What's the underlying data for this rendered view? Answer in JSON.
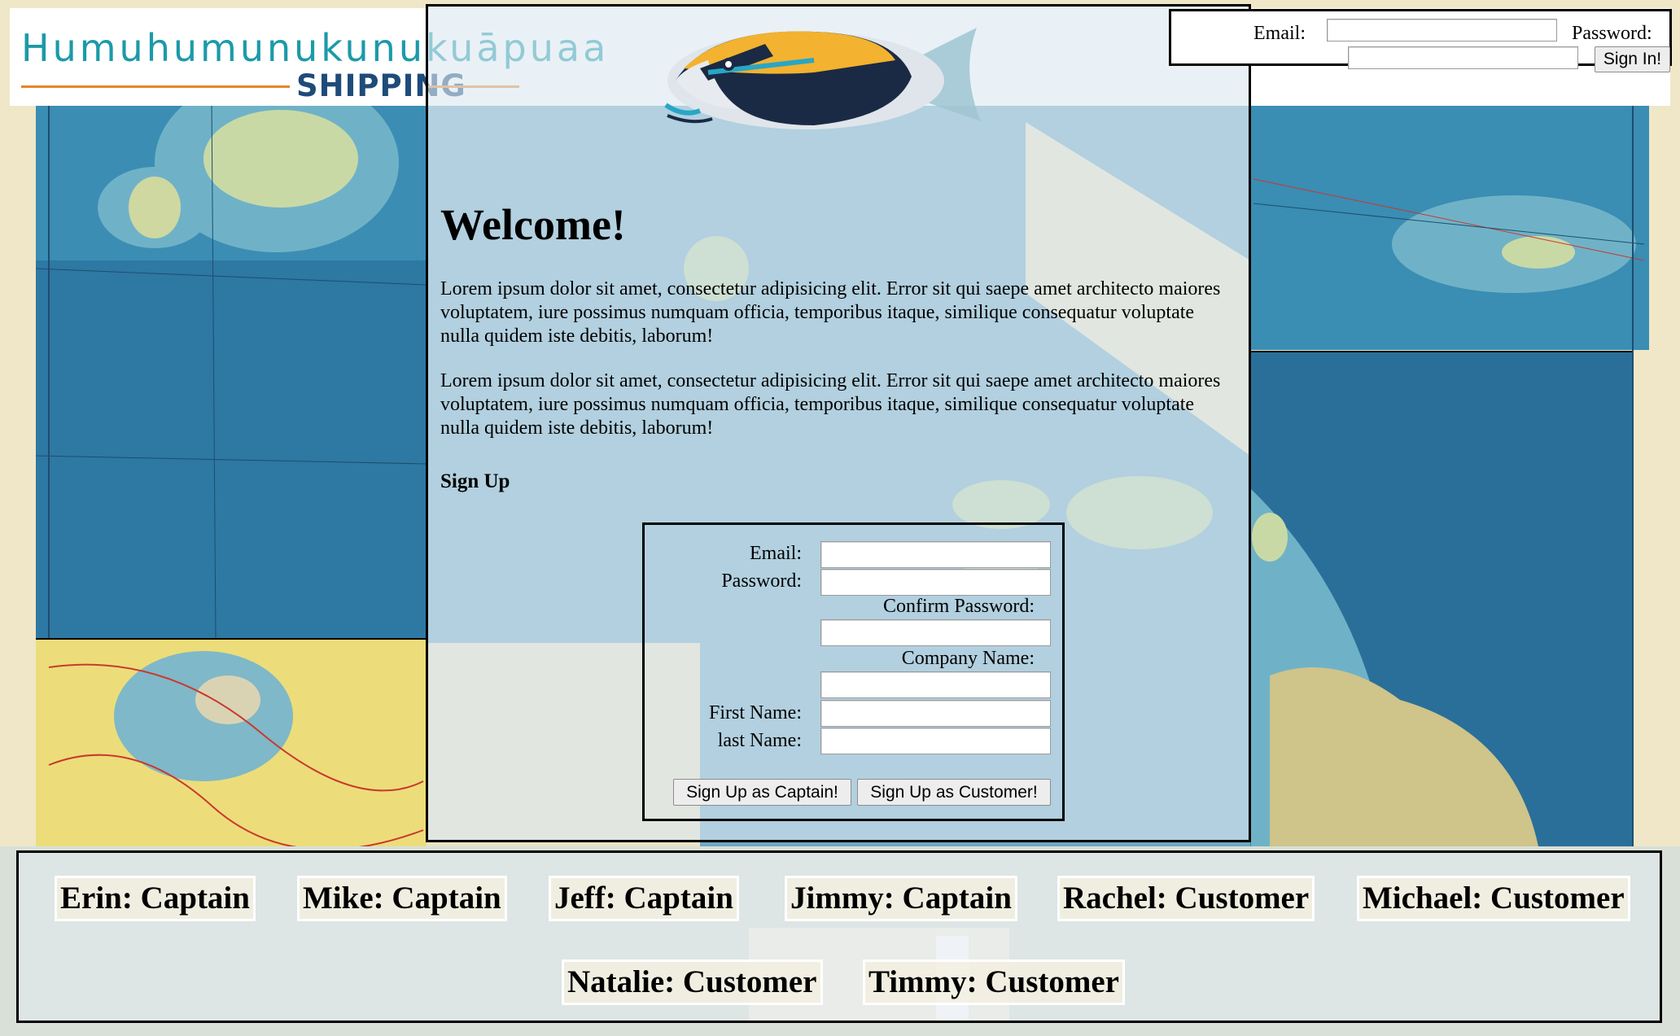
{
  "header": {
    "logo_title": "Humuhumunukunukuāpuaa",
    "logo_subtitle": "SHIPPING",
    "colors": {
      "logo_title": "#1b9aa8",
      "logo_subtitle": "#1e4b7a",
      "logo_rule": "#e8862a"
    }
  },
  "signin": {
    "email_label": "Email:",
    "password_label": "Password:",
    "email_value": "",
    "password_value": "",
    "button_label": "Sign In!"
  },
  "main": {
    "title": "Welcome!",
    "paragraphs": [
      "Lorem ipsum dolor sit amet, consectetur adipisicing elit. Error sit qui saepe amet architecto maiores voluptatem, iure possimus numquam officia, temporibus itaque, similique consequatur voluptate nulla quidem iste debitis, laborum!",
      "Lorem ipsum dolor sit amet, consectetur adipisicing elit. Error sit qui saepe amet architecto maiores voluptatem, iure possimus numquam officia, temporibus itaque, similique consequatur voluptate nulla quidem iste debitis, laborum!"
    ],
    "signup_heading": "Sign Up"
  },
  "signup_form": {
    "email_label": "Email:",
    "password_label": "Password:",
    "confirm_password_label": "Confirm Password:",
    "company_name_label": "Company Name:",
    "first_name_label": "First Name:",
    "last_name_label": "last Name:",
    "captain_button": "Sign Up as Captain!",
    "customer_button": "Sign Up as Customer!"
  },
  "users": [
    {
      "label": "Erin: Captain"
    },
    {
      "label": "Mike: Captain"
    },
    {
      "label": "Jeff: Captain"
    },
    {
      "label": "Jimmy: Captain"
    },
    {
      "label": "Rachel: Customer"
    },
    {
      "label": "Michael: Customer"
    },
    {
      "label": "Natalie: Customer"
    },
    {
      "label": "Timmy: Customer"
    }
  ],
  "icons": {
    "fish": "humuhumu-fish-icon",
    "map": "hawaii-map-background"
  }
}
